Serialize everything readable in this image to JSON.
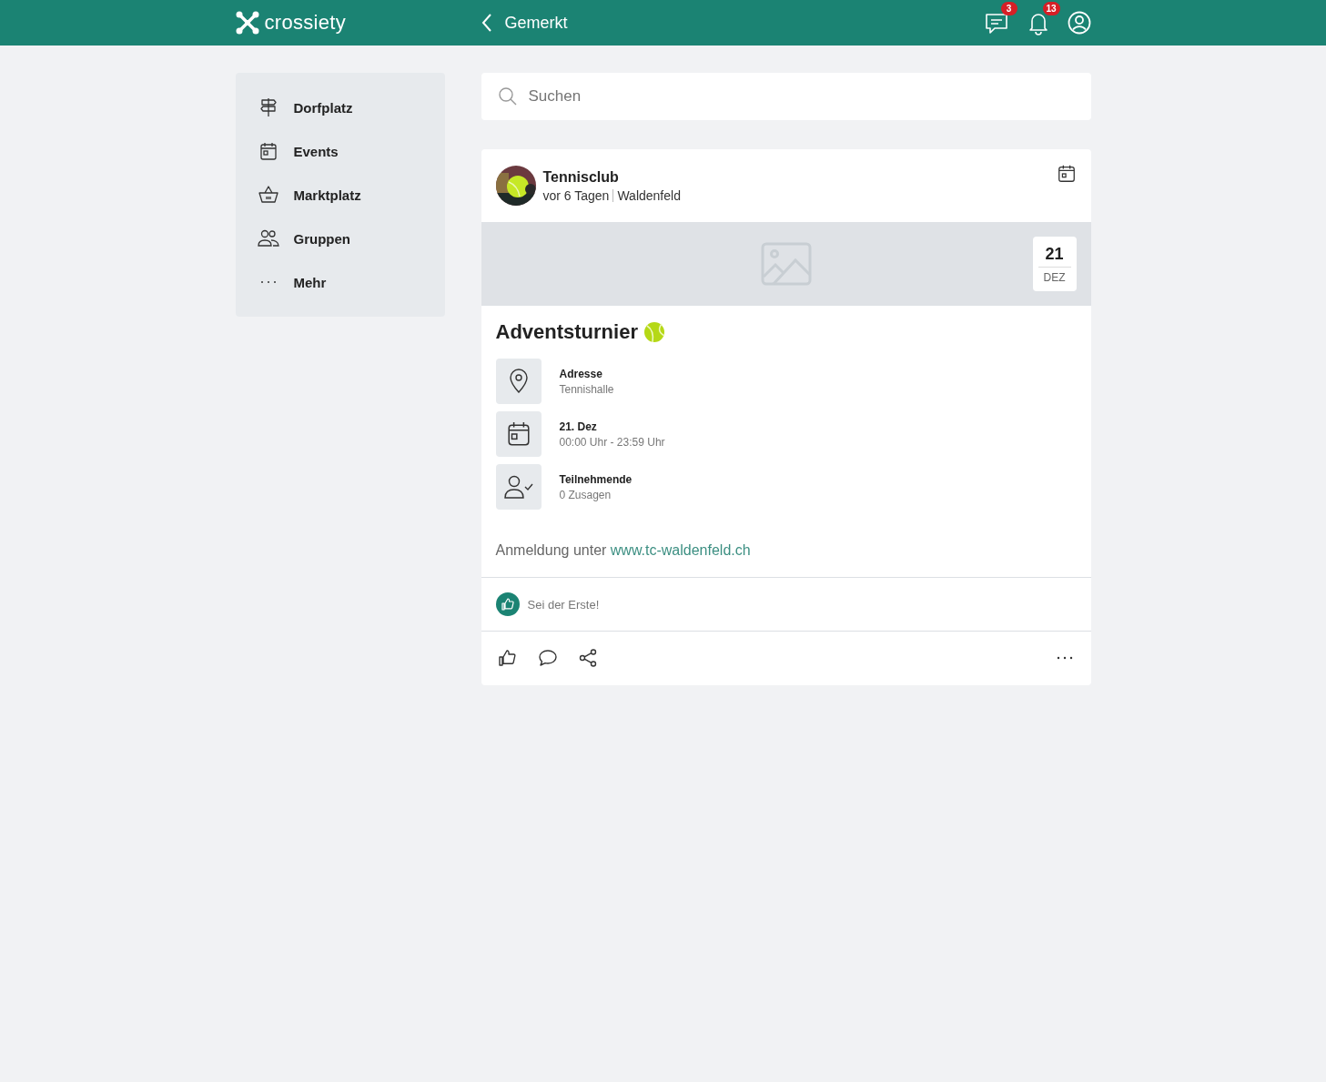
{
  "header": {
    "logo": "crossiety",
    "title": "Gemerkt",
    "badges": [
      {
        "kind": "messages",
        "count": "3"
      },
      {
        "kind": "notifications",
        "count": "13"
      }
    ]
  },
  "sidebar": {
    "items": [
      {
        "kind": "signpost",
        "label": "Dorfplatz"
      },
      {
        "kind": "calendar",
        "label": "Events"
      },
      {
        "kind": "basket",
        "label": "Marktplatz"
      },
      {
        "kind": "people",
        "label": "Gruppen"
      },
      {
        "kind": "more",
        "label": "Mehr"
      }
    ]
  },
  "search": {
    "placeholder": "Suchen"
  },
  "post": {
    "author": "Tennisclub",
    "time": "vor 6 Tagen",
    "place": "Waldenfeld",
    "date_day": "21",
    "date_month": "DEZ",
    "title": "Adventsturnier",
    "details": [
      {
        "kind": "location",
        "label": "Adresse",
        "value": "Tennishalle"
      },
      {
        "kind": "date",
        "label": "21. Dez",
        "value": "00:00 Uhr - 23:59 Uhr"
      },
      {
        "kind": "participants",
        "label": "Teilnehmende",
        "value": "0 Zusagen"
      }
    ],
    "text": "Anmeldung unter",
    "link": "www.tc-waldenfeld.ch",
    "reactions": "Sei der Erste!"
  }
}
